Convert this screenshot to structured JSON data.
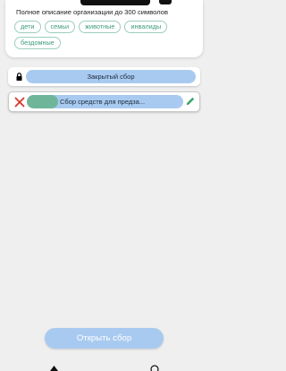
{
  "organization": {
    "description": "Полное описание организации до 300 символов",
    "tags": [
      "дети",
      "семьи",
      "животные",
      "инвалиды",
      "бездомные"
    ]
  },
  "fundraisers": [
    {
      "label": "Закрытый сбор",
      "status": "closed",
      "icon": "lock-icon"
    },
    {
      "label": "Сбор средств для предза...",
      "status": "active",
      "progress": 0.2,
      "icon": "close-icon",
      "edit_icon": "pencil-icon"
    }
  ],
  "actions": {
    "open_button": "Открыть сбор"
  },
  "colors": {
    "background": "#efefef",
    "pill": "#a9caf0",
    "progress": "#6fb59a",
    "tag_text": "#3f9b7d",
    "danger": "#d9362b",
    "edit": "#3aa56a"
  }
}
